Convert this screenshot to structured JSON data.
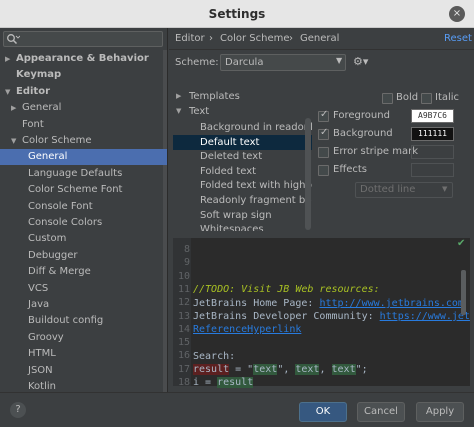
{
  "window": {
    "title": "Settings",
    "close_glyph": "×"
  },
  "search": {
    "placeholder": "",
    "icon": "search-icon"
  },
  "sidebar": {
    "items": [
      {
        "label": "Appearance & Behavior",
        "bold": true,
        "arrow": "▶"
      },
      {
        "label": "Keymap",
        "bold": true
      },
      {
        "label": "Editor",
        "bold": true,
        "arrow": "▼"
      },
      {
        "label": "General",
        "arrow": "▶"
      },
      {
        "label": "Font"
      },
      {
        "label": "Color Scheme",
        "arrow": "▼"
      },
      {
        "label": "General",
        "selected": true
      },
      {
        "label": "Language Defaults"
      },
      {
        "label": "Color Scheme Font"
      },
      {
        "label": "Console Font"
      },
      {
        "label": "Console Colors"
      },
      {
        "label": "Custom"
      },
      {
        "label": "Debugger"
      },
      {
        "label": "Diff & Merge"
      },
      {
        "label": "VCS"
      },
      {
        "label": "Java"
      },
      {
        "label": "Buildout config"
      },
      {
        "label": "Groovy"
      },
      {
        "label": "HTML"
      },
      {
        "label": "JSON"
      },
      {
        "label": "Kotlin"
      }
    ]
  },
  "breadcrumb": {
    "parts": [
      "Editor",
      "Color Scheme",
      "General"
    ],
    "separator": "›"
  },
  "reset_label": "Reset",
  "scheme": {
    "label": "Scheme:",
    "value": "Darcula"
  },
  "groups": {
    "templates": "Templates",
    "text": "Text",
    "collapsed_arrow": "▶",
    "expanded_arrow": "▼"
  },
  "text_items": [
    {
      "label": "Background in readonly fi"
    },
    {
      "label": "Default text",
      "selected": true
    },
    {
      "label": "Deleted text"
    },
    {
      "label": "Folded text"
    },
    {
      "label": "Folded text with highlight"
    },
    {
      "label": "Readonly fragment backg"
    },
    {
      "label": "Soft wrap sign"
    },
    {
      "label": "Whitespaces"
    }
  ],
  "options": {
    "bold": {
      "label": "Bold",
      "checked": false
    },
    "italic": {
      "label": "Italic",
      "checked": false
    },
    "foreground": {
      "label": "Foreground",
      "checked": true,
      "value": "A9B7C6",
      "bg": "#ffffff",
      "fg": "#333333"
    },
    "background": {
      "label": "Background",
      "checked": true,
      "value": "111111",
      "bg": "#111111",
      "fg": "#ffffff"
    },
    "error_stripe": {
      "label": "Error stripe mark",
      "checked": false
    },
    "effects": {
      "label": "Effects",
      "checked": false
    },
    "effect_type": "Dotted line"
  },
  "preview": {
    "line_numbers": [
      "8",
      "9",
      "10",
      "11",
      "12",
      "13",
      "14",
      "15",
      "16",
      "17",
      "18"
    ],
    "lines": {
      "l10": "//TODO: Visit JB Web resources:",
      "l11_text": "JetBrains Home Page: ",
      "l11_link": "http://www.jetbrains.com",
      "l12_text": "JetBrains Developer Community: ",
      "l12_link": "https://www.jet",
      "l13_link": "ReferenceHyperlink",
      "l15": "Search:",
      "l16_a": "result",
      "l16_b": " = \"",
      "l16_c": "text",
      "l16_d": "\", ",
      "l16_e": "text",
      "l16_f": ", ",
      "l16_g": "text",
      "l16_h": "\";",
      "l17_a": "i",
      "l17_b": " = ",
      "l17_c": "result"
    },
    "colors": {
      "todo": "#a8c023",
      "link": "#287bde",
      "search_bg": "#32593d",
      "write_bg": "#5c2020",
      "text": "#a9b7c6"
    }
  },
  "buttons": {
    "ok": "OK",
    "cancel": "Cancel",
    "apply": "Apply",
    "help": "?"
  }
}
